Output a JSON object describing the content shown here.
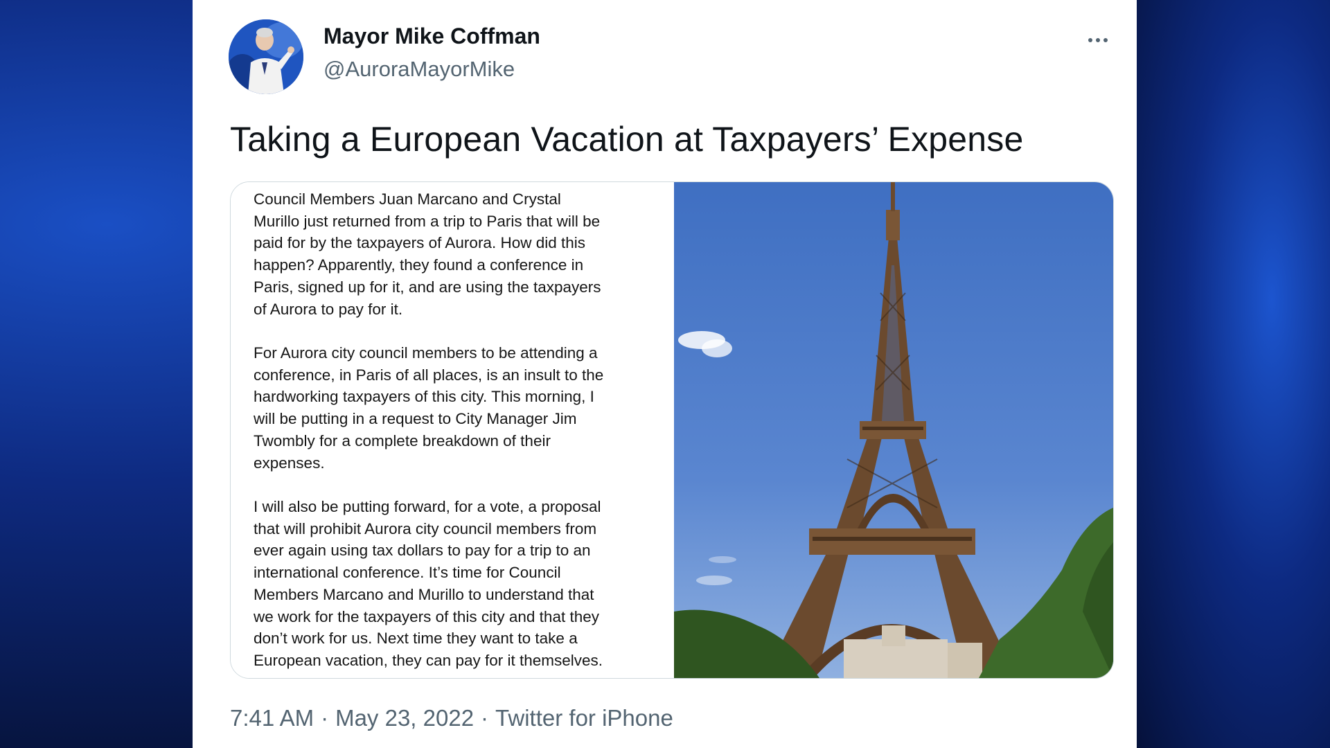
{
  "author": {
    "name": "Mayor Mike Coffman",
    "handle": "@AuroraMayorMike",
    "avatar_icon": "user-avatar-photo"
  },
  "menu": {
    "more_icon": "more-horizontal-icon"
  },
  "tweet": {
    "text": "Taking a European Vacation at Taxpayers’ Expense"
  },
  "media": {
    "letter": {
      "paragraphs": [
        [
          "Council Members Juan Marcano and Crystal",
          "Murillo just returned from a trip to Paris that will be",
          "paid for by the taxpayers of Aurora.  How did this",
          "happen?  Apparently, they found a conference in",
          "Paris, signed up for it, and are using the taxpayers",
          "of Aurora to pay for it."
        ],
        [
          "For Aurora city council members to be attending a",
          "conference, in Paris of all places, is an insult to the",
          "hardworking taxpayers of this city.  This morning, I",
          "will be putting in a request to City Manager Jim",
          "Twombly for a complete breakdown of their",
          "expenses."
        ],
        [
          "I will also be putting forward, for a vote, a proposal",
          "that will prohibit Aurora city council members from",
          "ever again using tax dollars to pay for a trip to an",
          "international conference.  It’s time for Council",
          "Members Marcano and Murillo to understand that",
          "we work for the taxpayers of this city and that they",
          "don’t work for us.  Next time they want to take a",
          "European vacation, they can pay for it themselves."
        ]
      ]
    },
    "photo": {
      "subject": "eiffel-tower-photo",
      "sky_color": "#4a78c8",
      "tower_color": "#6b4a2e",
      "trees_color": "#3d6a2a"
    }
  },
  "meta": {
    "time": "7:41 AM",
    "separator": "·",
    "date": "May 23, 2022",
    "source": "Twitter for iPhone"
  }
}
